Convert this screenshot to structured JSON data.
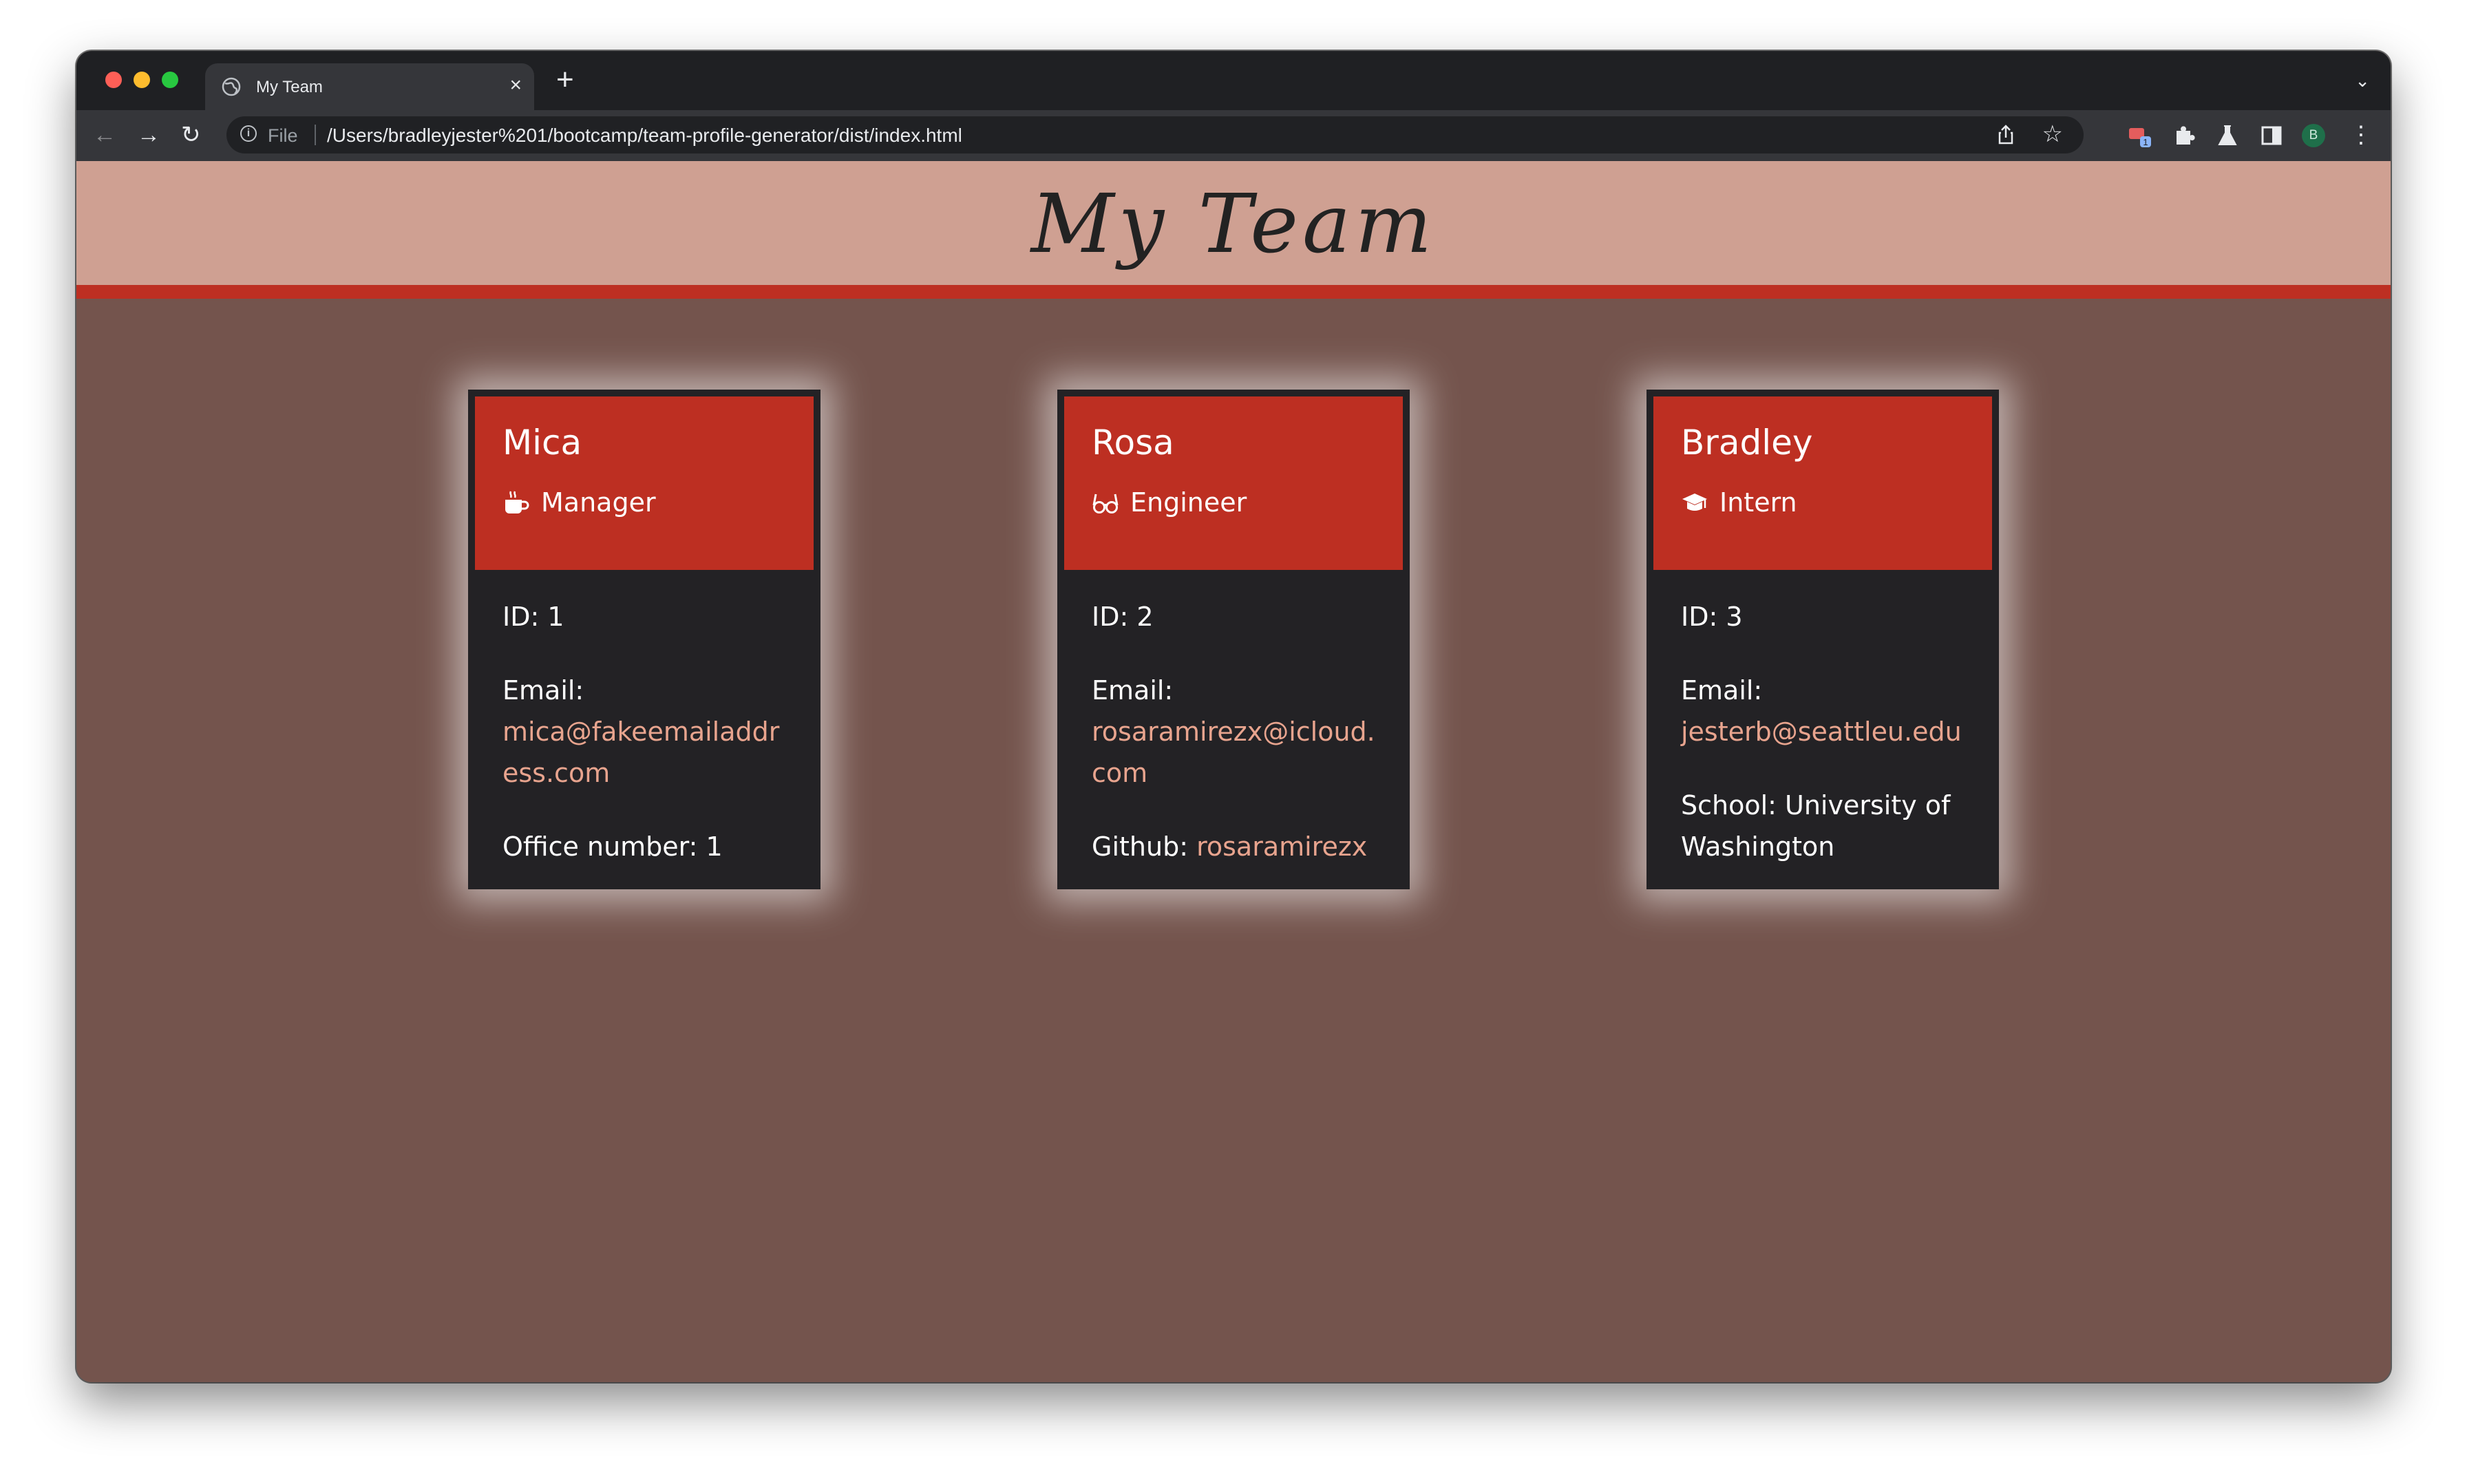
{
  "browser": {
    "tab_title": "My Team",
    "tab_close": "×",
    "new_tab": "+",
    "scheme": "File",
    "url": "/Users/bradleyjester%201/bootcamp/team-profile-generator/dist/index.html",
    "avatar_letter": "B",
    "extension_badge": "1"
  },
  "page": {
    "heading": "My Team"
  },
  "team": [
    {
      "name": "Mica",
      "role": "Manager",
      "role_icon": "coffee-icon",
      "id": "ID: 1",
      "email_label": "Email:",
      "email": "mica@fakeemailaddress.com",
      "extra_label": "Office number: 1",
      "extra_value": ""
    },
    {
      "name": "Rosa",
      "role": "Engineer",
      "role_icon": "glasses-icon",
      "id": "ID: 2",
      "email_label": "Email:",
      "email": "rosaramirezx@icloud.com",
      "extra_label": "Github: ",
      "extra_value": "rosaramirezx"
    },
    {
      "name": "Bradley",
      "role": "Intern",
      "role_icon": "graduation-cap-icon",
      "id": "ID: 3",
      "email_label": "Email:",
      "email": "jesterb@seattleu.edu",
      "extra_label": "School: University of Washington",
      "extra_value": ""
    }
  ],
  "colors": {
    "header_bg": "#cfa092",
    "accent": "#bd2f22",
    "page_bg": "#74544d",
    "card_bg": "#232225",
    "link": "#e8a48e"
  }
}
